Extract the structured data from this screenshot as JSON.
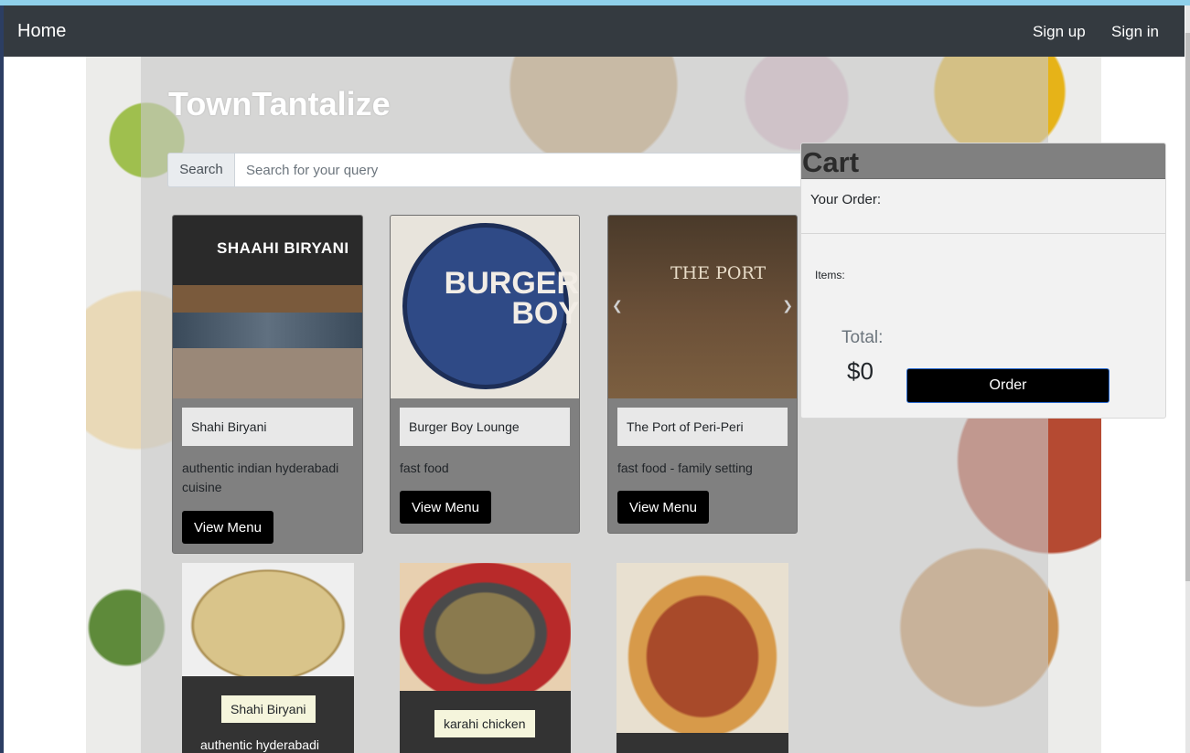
{
  "navbar": {
    "home_label": "Home",
    "signup_label": "Sign up",
    "signin_label": "Sign in"
  },
  "header": {
    "site_title": "TownTantalize"
  },
  "search": {
    "addon_label": "Search",
    "placeholder": "Search for your query",
    "value": ""
  },
  "restaurants": [
    {
      "sign_text": "SHAAHI BIRYANI",
      "name": "Shahi Biryani",
      "description": "authentic indian hyderabadi cuisine",
      "button_label": "View Menu"
    },
    {
      "sign_text": "BURGER BOY",
      "name": "Burger Boy Lounge",
      "description": "fast food",
      "button_label": "View Menu"
    },
    {
      "sign_text": "THE PORT",
      "name": "The Port of Peri-Peri",
      "description": "fast food - family setting",
      "button_label": "View Menu"
    }
  ],
  "dishes": [
    {
      "name": "Shahi Biryani",
      "caption": "authentic hyderabadi"
    },
    {
      "name": "karahi chicken",
      "caption": ""
    },
    {
      "name": "",
      "caption": ""
    }
  ],
  "cart": {
    "title": "Cart",
    "order_label": "Your Order:",
    "items_label": "Items:",
    "total_label": "Total:",
    "total_value": "$0",
    "order_button_label": "Order"
  },
  "icons": {
    "carousel_prev": "chevron-left-icon",
    "carousel_next": "chevron-right-icon"
  },
  "colors": {
    "navbar": "#343a40",
    "card": "#808080",
    "button": "#000000",
    "cart_header": "#808080",
    "dish_tag": "#f5f5dc"
  }
}
